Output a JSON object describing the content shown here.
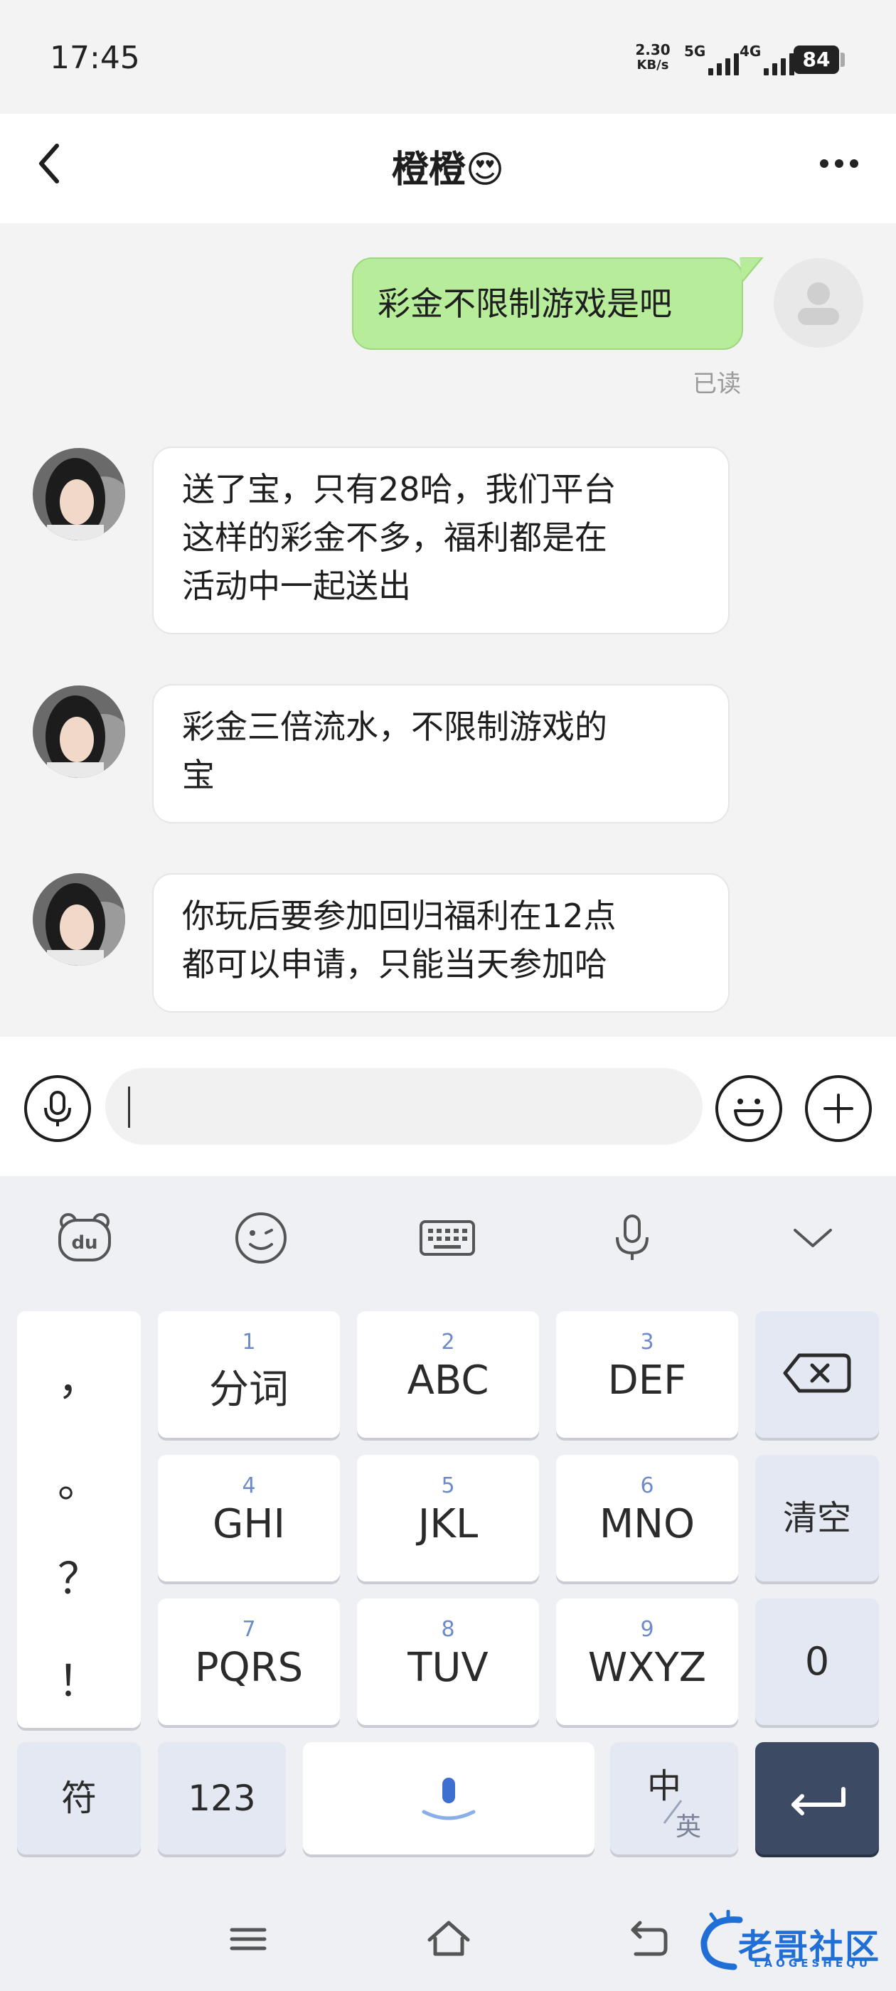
{
  "status_bar": {
    "time": "17:45",
    "net_speed_value": "2.30",
    "net_speed_unit": "KB/s",
    "sim1": "5G",
    "sim2": "4G",
    "battery": "84"
  },
  "header": {
    "title": "橙橙😍",
    "back_icon": "chevron-left-icon",
    "more_icon": "more-horizontal-icon"
  },
  "messages": [
    {
      "direction": "out",
      "text": "彩金不限制游戏是吧",
      "status": "已读"
    },
    {
      "direction": "in",
      "lines": [
        "送了宝，只有28哈，我们平台",
        "这样的彩金不多，福利都是在",
        "活动中一起送出"
      ]
    },
    {
      "direction": "in",
      "lines": [
        "彩金三倍流水，不限制游戏的",
        "宝"
      ]
    },
    {
      "direction": "in",
      "lines": [
        "你玩后要参加回归福利在12点",
        "都可以申请，只能当天参加哈"
      ]
    }
  ],
  "input_bar": {
    "voice_icon": "microphone-icon",
    "emoji_icon": "smiley-icon",
    "plus_icon": "plus-icon",
    "value": ""
  },
  "keyboard": {
    "toolbar": [
      "du-bear-logo-icon",
      "emoji-icon",
      "keyboard-icon",
      "microphone-icon",
      "chevron-down-icon"
    ],
    "punctuation": [
      "，",
      "。",
      "？",
      "！"
    ],
    "keys": [
      {
        "num": "1",
        "label": "分词"
      },
      {
        "num": "2",
        "label": "ABC"
      },
      {
        "num": "3",
        "label": "DEF"
      },
      {
        "num": "4",
        "label": "GHI"
      },
      {
        "num": "5",
        "label": "JKL"
      },
      {
        "num": "6",
        "label": "MNO"
      },
      {
        "num": "7",
        "label": "PQRS"
      },
      {
        "num": "8",
        "label": "TUV"
      },
      {
        "num": "9",
        "label": "WXYZ"
      }
    ],
    "clear_label": "清空",
    "zero_label": "0",
    "symbol_label": "符",
    "num_label": "123",
    "lang_top": "中",
    "lang_bottom": "英"
  },
  "watermark": {
    "text": "老哥社区",
    "subtext": "LAOGESHEQU"
  },
  "colors": {
    "outgoing_bubble": "#b6ec9a",
    "incoming_bubble": "#ffffff",
    "enter_key": "#3d4a63",
    "number_hint": "#6d8ac9",
    "watermark_blue": "#1f6fd6"
  }
}
